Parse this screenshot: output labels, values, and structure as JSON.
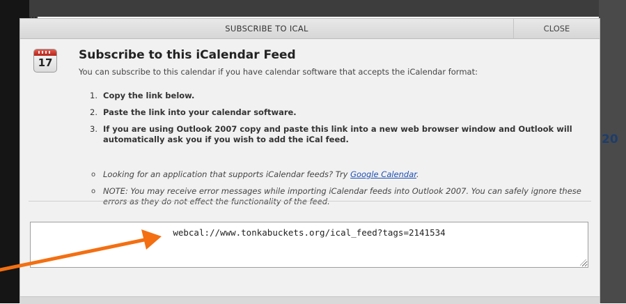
{
  "dialog": {
    "title": "SUBSCRIBE TO ICAL",
    "close_label": "CLOSE",
    "icon": "calendar-icon",
    "icon_day": "17",
    "heading": "Subscribe to this iCalendar Feed",
    "intro": "You can subscribe to this calendar if you have calendar software that accepts the iCalendar format:",
    "steps": [
      {
        "num": "1.",
        "text": "Copy the link below."
      },
      {
        "num": "2.",
        "text": "Paste the link into your calendar software."
      },
      {
        "num": "3.",
        "text": "If you are using Outlook 2007 copy and paste this link into a new web browser window and Outlook will automatically ask you if you wish to add the iCal feed."
      }
    ],
    "notes": [
      {
        "bullet": "o",
        "before": "Looking for an application that supports iCalendar feeds? Try ",
        "link": "Google Calendar",
        "after": "."
      },
      {
        "bullet": "o",
        "text": "NOTE: You may receive error messages while importing iCalendar feeds into Outlook 2007. You can safely ignore these errors as they do not effect the functionality of the feed."
      }
    ],
    "feed_url": "webcal://www.tonkabuckets.org/ical_feed?tags=2141534"
  },
  "background": {
    "number": "20"
  },
  "colors": {
    "arrow": "#f36f12",
    "link": "#1e4fb5",
    "calendar_header": "#c9372c"
  }
}
